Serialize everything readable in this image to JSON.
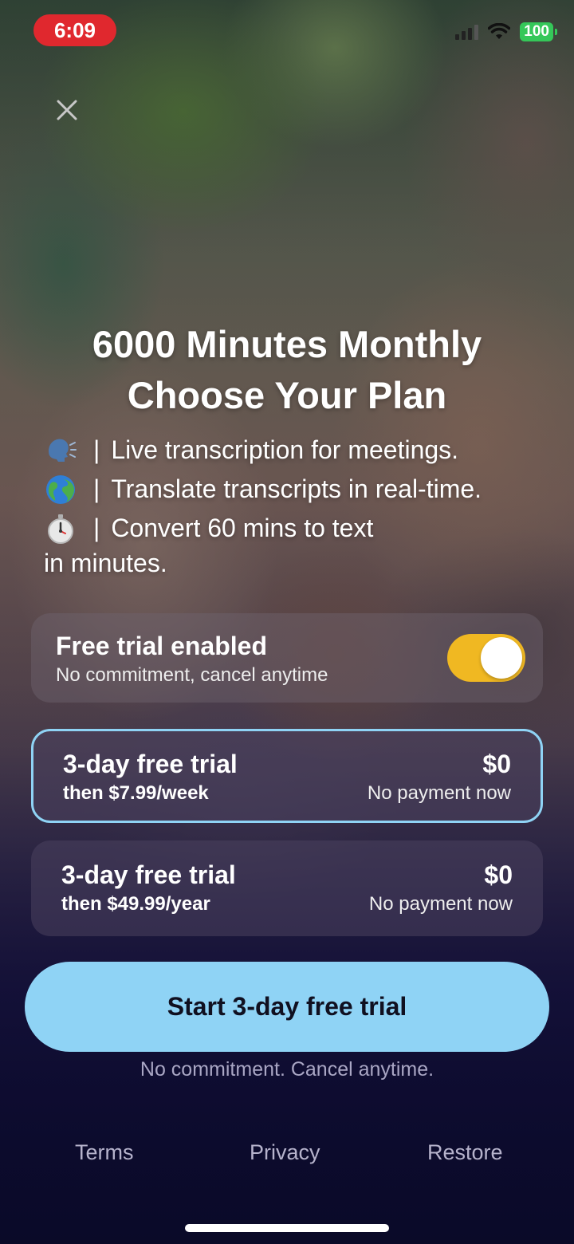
{
  "status_bar": {
    "time": "6:09",
    "battery": "100"
  },
  "headline": {
    "line1": "6000 Minutes Monthly",
    "line2": "Choose Your Plan"
  },
  "features": [
    {
      "icon": "speaking-head-icon",
      "separator": "|",
      "text": "Live transcription for meetings."
    },
    {
      "icon": "globe-icon",
      "separator": "|",
      "text": "Translate transcripts in real-time."
    },
    {
      "icon": "stopwatch-icon",
      "separator": "|",
      "text": "Convert 60 mins to text",
      "continuation": "in minutes."
    }
  ],
  "free_trial_toggle": {
    "title": "Free trial enabled",
    "subtitle": "No commitment, cancel anytime",
    "enabled": true
  },
  "plans": [
    {
      "title": "3-day free trial",
      "subtitle": "then $7.99/week",
      "price": "$0",
      "note": "No payment now",
      "selected": true
    },
    {
      "title": "3-day free trial",
      "subtitle": "then $49.99/year",
      "price": "$0",
      "note": "No payment now",
      "selected": false
    }
  ],
  "cta": {
    "label": "Start 3-day free trial",
    "note": "No commitment. Cancel anytime."
  },
  "footer": {
    "terms": "Terms",
    "privacy": "Privacy",
    "restore": "Restore"
  },
  "colors": {
    "accent": "#8fd3f5",
    "toggle_on": "#f0b822",
    "time_pill": "#e0282e",
    "battery": "#35c759"
  }
}
